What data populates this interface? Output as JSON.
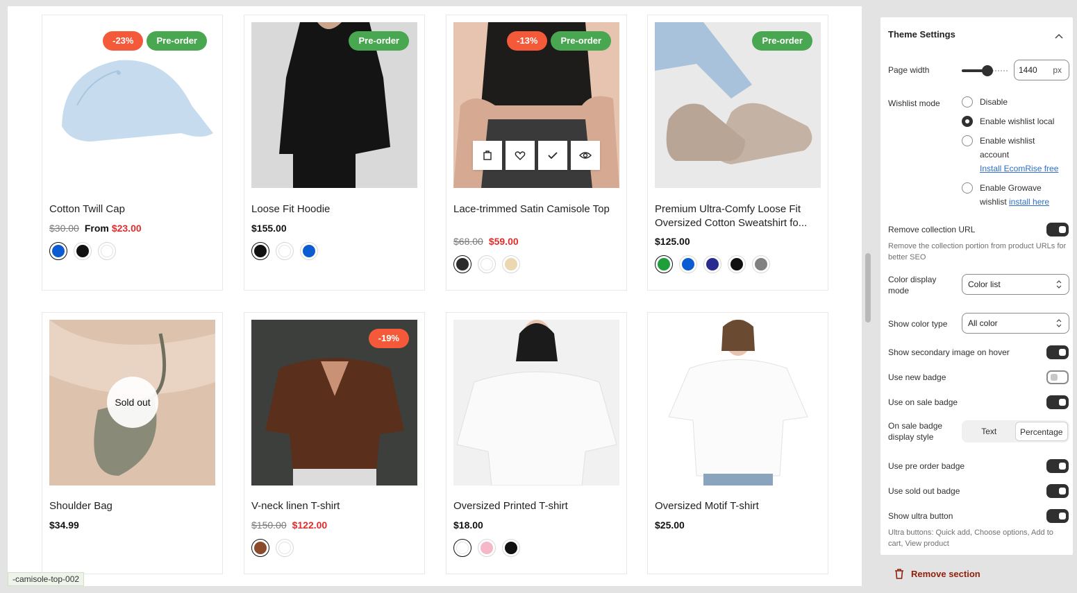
{
  "products": [
    {
      "title": "Cotton Twill Cap",
      "old_price": "$30.00",
      "from": "From",
      "price": "$23.00",
      "badges": [
        "-23%",
        "Pre-order"
      ],
      "swatches": [
        "#0b5bd3",
        "#111111",
        "#ffffff"
      ]
    },
    {
      "title": "Loose Fit Hoodie",
      "price": "$155.00",
      "badges": [
        "Pre-order"
      ],
      "swatches": [
        "#111111",
        "#ffffff",
        "#0b5bd3"
      ]
    },
    {
      "title": "Lace-trimmed Satin Camisole Top",
      "old_price": "$68.00",
      "price": "$59.00",
      "badges": [
        "-13%",
        "Pre-order"
      ],
      "swatches": [
        "#2a2a2a",
        "#ffffff",
        "#ead9b0"
      ]
    },
    {
      "title": "Premium Ultra-Comfy Loose Fit Oversized Cotton Sweatshirt fo...",
      "price": "$125.00",
      "badges": [
        "Pre-order"
      ],
      "swatches": [
        "#1f9e3c",
        "#0b5bd3",
        "#2a2b8f",
        "#111111",
        "#808080"
      ]
    },
    {
      "title": "Shoulder Bag",
      "price": "$34.99",
      "sold_out": "Sold out"
    },
    {
      "title": "V-neck linen T-shirt",
      "old_price": "$150.00",
      "price": "$122.00",
      "badges": [
        "-19%"
      ],
      "swatches": [
        "#8b4a2b",
        "#ffffff"
      ]
    },
    {
      "title": "Oversized Printed T-shirt",
      "price": "$18.00",
      "swatches": [
        "#ffffff",
        "#f6b8c9",
        "#111111"
      ]
    },
    {
      "title": "Oversized Motif T-shirt",
      "price": "$25.00"
    }
  ],
  "status_url": "-camisole-top-002",
  "settings": {
    "title": "Theme Settings",
    "page_width_label": "Page width",
    "page_width_value": "1440",
    "page_width_unit": "px",
    "page_width_fraction": 0.55,
    "wishlist_label": "Wishlist mode",
    "wishlist_options": [
      "Disable",
      "Enable wishlist local",
      "Enable wishlist account",
      "Enable Growave wishlist"
    ],
    "wishlist_link_1": "Install EcomRise free",
    "wishlist_link_2": "install here",
    "wishlist_selected": "Enable wishlist local",
    "remove_collection_label": "Remove collection URL",
    "remove_collection_help": "Remove the collection portion from product URLs for better SEO",
    "color_display_label": "Color display mode",
    "color_display_value": "Color list",
    "color_type_label": "Show color type",
    "color_type_value": "All color",
    "secondary_image_label": "Show secondary image on hover",
    "new_badge_label": "Use new badge",
    "on_sale_badge_label": "Use on sale badge",
    "sale_style_label": "On sale badge display style",
    "sale_style_options": [
      "Text",
      "Percentage"
    ],
    "sale_style_selected": "Percentage",
    "pre_order_label": "Use pre order badge",
    "sold_out_label": "Use sold out badge",
    "ultra_label": "Show ultra button",
    "ultra_help": "Ultra buttons: Quick add, Choose options, Add to cart, View product"
  },
  "remove_section": "Remove section",
  "colors": {
    "sale": "#e32b2b",
    "badge_sale": "#f4593a",
    "badge_pre": "#4aa751",
    "link": "#2c6ecb",
    "danger": "#8e1f0b"
  }
}
